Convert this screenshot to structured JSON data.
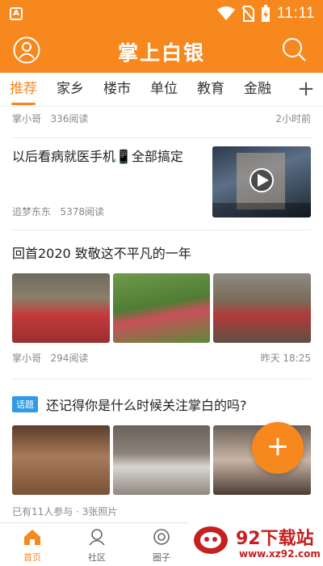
{
  "status_bar": {
    "time": "11:11",
    "left_badge": "A"
  },
  "header": {
    "title": "掌上白银"
  },
  "tabs": [
    {
      "label": "推荐",
      "active": true
    },
    {
      "label": "家乡",
      "active": false
    },
    {
      "label": "楼市",
      "active": false
    },
    {
      "label": "单位",
      "active": false
    },
    {
      "label": "教育",
      "active": false
    },
    {
      "label": "金融",
      "active": false
    }
  ],
  "tab_add": "+",
  "feed": {
    "item1": {
      "author": "掌小哥",
      "reads": "336阅读",
      "time": "2小时前"
    },
    "item2": {
      "title": "以后看病就医手机📱全部搞定",
      "author": "追梦东东",
      "reads": "5378阅读"
    },
    "item3": {
      "title": "回首2020 致敬这不平凡的一年",
      "author": "掌小哥",
      "reads": "294阅读",
      "time": "昨天 18:25"
    },
    "item4": {
      "tag": "话题",
      "title": "还记得你是什么时候关注掌白的吗?",
      "meta": "已有11人参与 · 3张照片"
    }
  },
  "fab_label": "+",
  "bottom_nav": [
    {
      "label": "首页",
      "active": true
    },
    {
      "label": "社区",
      "active": false
    },
    {
      "label": "圈子",
      "active": false
    }
  ],
  "watermark": {
    "big": "92下载站",
    "small": "www.xz92.com"
  },
  "colors": {
    "brand": "#f7881d",
    "tag": "#2f9be6",
    "watermark": "#c62020"
  }
}
